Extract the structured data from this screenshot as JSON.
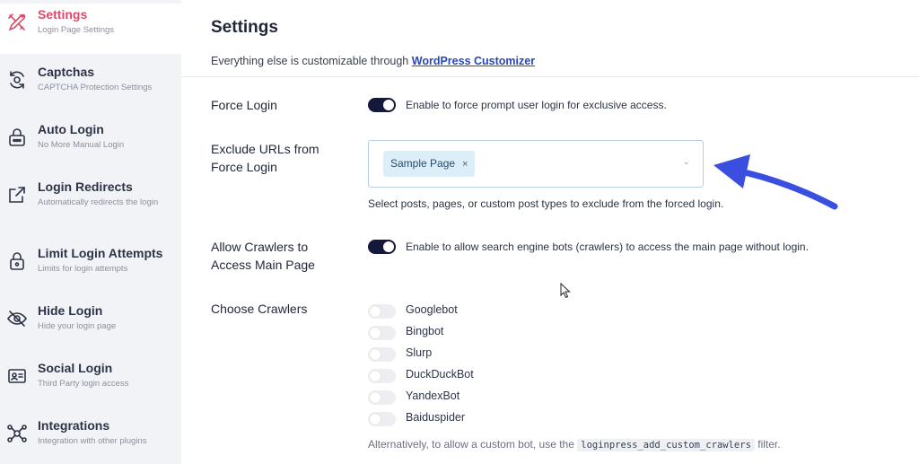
{
  "sidebar": {
    "items": [
      {
        "label": "Settings",
        "subtitle": "Login Page Settings",
        "icon": "tools-icon",
        "active": true
      },
      {
        "label": "Captchas",
        "subtitle": "CAPTCHA Protection Settings",
        "icon": "captcha-icon",
        "active": false
      },
      {
        "label": "Auto Login",
        "subtitle": "No More Manual Login",
        "icon": "auto-login-icon",
        "active": false
      },
      {
        "label": "Login Redirects",
        "subtitle": "Automatically redirects the login",
        "icon": "redirect-icon",
        "active": false
      },
      {
        "label": "Limit Login Attempts",
        "subtitle": "Limits for login attempts",
        "icon": "lock-icon",
        "active": false
      },
      {
        "label": "Hide Login",
        "subtitle": "Hide your login page",
        "icon": "eye-slash-icon",
        "active": false
      },
      {
        "label": "Social Login",
        "subtitle": "Third Party login access",
        "icon": "id-card-icon",
        "active": false
      },
      {
        "label": "Integrations",
        "subtitle": "Integration with other plugins",
        "icon": "integrations-icon",
        "active": false
      }
    ]
  },
  "main": {
    "title": "Settings",
    "intro_text": "Everything else is customizable through",
    "intro_link": "WordPress Customizer",
    "force_login": {
      "label": "Force Login",
      "enabled": true,
      "description": "Enable to force prompt user login for exclusive access."
    },
    "exclude_urls": {
      "label_line1": "Exclude URLs from",
      "label_line2": "Force Login",
      "selected": [
        "Sample Page"
      ],
      "remove_glyph": "×",
      "chevron_glyph": "⌄",
      "help": "Select posts, pages, or custom post types to exclude from the forced login."
    },
    "allow_crawlers": {
      "label_line1": "Allow Crawlers to",
      "label_line2": "Access Main Page",
      "enabled": true,
      "description": "Enable to allow search engine bots (crawlers) to access the main page without login."
    },
    "choose_crawlers": {
      "label": "Choose Crawlers",
      "items": [
        {
          "name": "Googlebot",
          "enabled": false
        },
        {
          "name": "Bingbot",
          "enabled": false
        },
        {
          "name": "Slurp",
          "enabled": false
        },
        {
          "name": "DuckDuckBot",
          "enabled": false
        },
        {
          "name": "YandexBot",
          "enabled": false
        },
        {
          "name": "Baiduspider",
          "enabled": false
        }
      ],
      "alt_prefix": "Alternatively, to allow a custom bot, use the",
      "alt_code": "loginpress_add_custom_crawlers",
      "alt_suffix": "filter."
    }
  },
  "colors": {
    "active_nav": "#e0486a",
    "toggle_on": "#14183a",
    "link": "#2747b5",
    "annotation_arrow": "#3a4fe0",
    "chip_bg": "#dceff8"
  }
}
